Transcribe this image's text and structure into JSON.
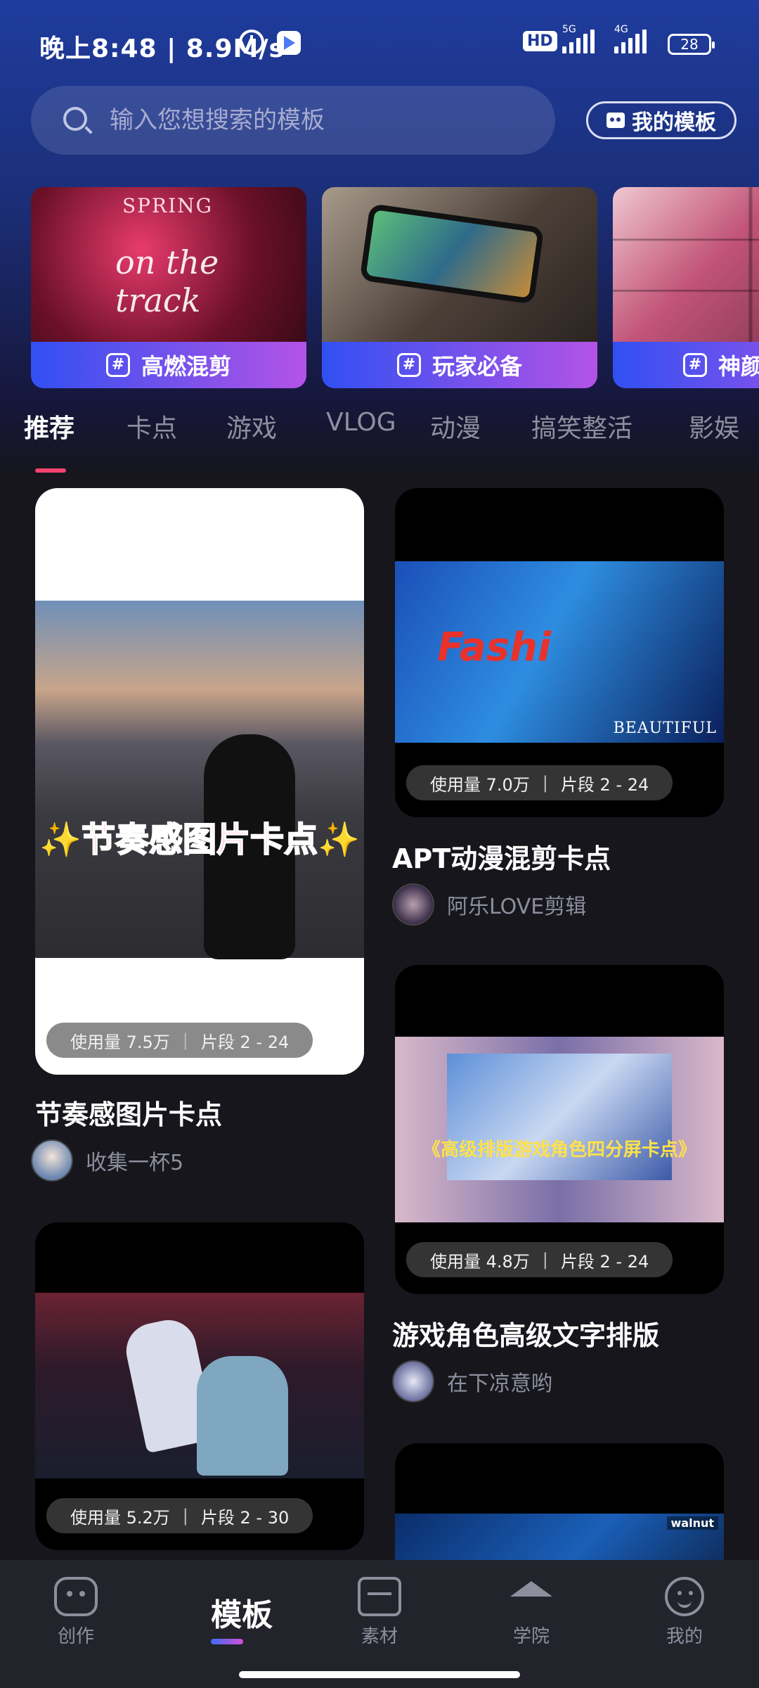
{
  "status_bar": {
    "time": "晚上8:48 | 8.9M/s",
    "hd": "HD",
    "signal_1": "5G",
    "signal_2": "4G",
    "battery": "28"
  },
  "search": {
    "placeholder": "输入您想搜索的模板"
  },
  "my_templates_label": "我的模板",
  "banners": [
    {
      "label": "高燃混剪",
      "art_title": "SPRING",
      "art_text": "on the track"
    },
    {
      "label": "玩家必备"
    },
    {
      "label": "神颜"
    }
  ],
  "tabs": [
    "推荐",
    "卡点",
    "游戏",
    "VLOG",
    "动漫",
    "搞笑整活",
    "影娱"
  ],
  "cards": [
    {
      "title": "节奏感图片卡点",
      "overlay_text": "✨节奏感图片卡点✨",
      "usage": "使用量 7.5万",
      "segments": "片段 2 - 24",
      "author": "收集一杯5"
    },
    {
      "title": "APT动漫混剪卡点",
      "overlay_text": "Fashi",
      "overlay_sub": "BEAUTIFUL",
      "usage": "使用量 7.0万",
      "segments": "片段 2 - 24",
      "author": "阿乐LOVE剪辑"
    },
    {
      "title": "游戏角色高级文字排版",
      "overlay_text": "《高级排版游戏角色四分屏卡点》",
      "usage": "使用量 4.8万",
      "segments": "片段 2 - 24",
      "author": "在下凉意哟"
    },
    {
      "usage": "使用量 5.2万",
      "segments": "片段 2 - 30"
    },
    {
      "overlay_text": "walnut"
    }
  ],
  "bottom_nav": {
    "create": "创作",
    "templates": "模板",
    "material": "素材",
    "academy": "学院",
    "mine": "我的"
  },
  "colors": {
    "accent_pink": "#f2426e",
    "banner_gradient_start": "#3150f2",
    "banner_gradient_end": "#b453e6",
    "background": "#16161c"
  }
}
